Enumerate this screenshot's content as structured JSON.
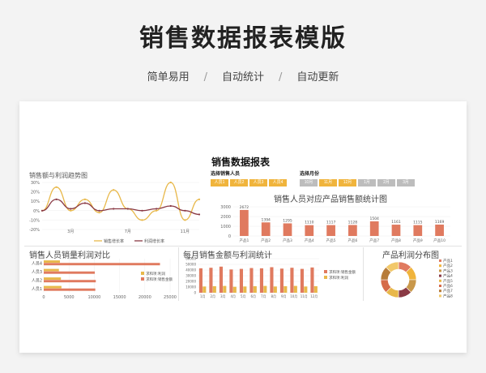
{
  "hero": {
    "title": "销售数据报表模版",
    "features": [
      "简单易用",
      "自动统计",
      "自动更新"
    ],
    "separator": "/"
  },
  "dashboard": {
    "title": "销售数据报表",
    "colors": {
      "primary": "#f0b43c",
      "bar": "#e07a5f",
      "line_dark": "#8a3a45",
      "line_gold": "#e8b84a",
      "chip_off": "#bdbdbd"
    },
    "trend_panel": {
      "title": "销售额与利润趋势图"
    },
    "person_selector": {
      "label": "选择销售人员",
      "options": [
        "人员1",
        "人员2",
        "人员3",
        "人员4"
      ]
    },
    "month_selector": {
      "label": "选择月份",
      "options": [
        "10月",
        "11月",
        "12月",
        "1月",
        "2月",
        "3月"
      ]
    },
    "product_panel": {
      "title": "销售人员对应产品销售额统计图"
    },
    "bar_panel": {
      "title": "销售人员销量利润对比"
    },
    "month_panel": {
      "title": "每月销售金额与利润统计"
    },
    "pie_panel": {
      "title": "产品利润分布图"
    }
  },
  "chart_data": [
    {
      "id": "trend",
      "type": "line",
      "x": [
        "1月",
        "2月",
        "3月",
        "4月",
        "5月",
        "6月",
        "7月",
        "8月",
        "9月",
        "10月",
        "11月",
        "12月"
      ],
      "xlabels": [
        "",
        "",
        "3月",
        "",
        "",
        "",
        "7月",
        "",
        "",
        "",
        "11月",
        ""
      ],
      "yticks": [
        "-20%",
        "-10%",
        "0%",
        "10%",
        "20%",
        "30%"
      ],
      "ylim": [
        -20,
        30
      ],
      "series": [
        {
          "name": "销售增长率",
          "values": [
            0,
            25,
            0,
            12,
            -2,
            22,
            2,
            -10,
            0,
            30,
            -10,
            12
          ]
        },
        {
          "name": "利润增长率",
          "values": [
            0,
            12,
            2,
            8,
            0,
            2,
            2,
            0,
            2,
            5,
            0,
            -4
          ]
        }
      ]
    },
    {
      "id": "product",
      "type": "bar",
      "categories": [
        "产品1",
        "产品2",
        "产品3",
        "产品4",
        "产品5",
        "产品6",
        "产品7",
        "产品8",
        "产品9",
        "产品10"
      ],
      "values": [
        2672,
        1394,
        1295,
        1110,
        1117,
        1128,
        1504,
        1161,
        1115,
        1169
      ],
      "yticks": [
        "0",
        "1000",
        "2000",
        "3000"
      ],
      "ylim": [
        0,
        3000
      ]
    },
    {
      "id": "person",
      "type": "bar",
      "orientation": "horizontal",
      "categories": [
        "人员1",
        "人员2",
        "人员3",
        "人员4"
      ],
      "xticks": [
        "0",
        "5000",
        "10000",
        "15000",
        "20000",
        "25000"
      ],
      "xlim": [
        0,
        25000
      ],
      "series": [
        {
          "name": "求和项:利润",
          "values": [
            3500,
            3400,
            3000,
            3200
          ]
        },
        {
          "name": "求和项:销售金额",
          "values": [
            10200,
            10300,
            10100,
            23000
          ]
        }
      ]
    },
    {
      "id": "monthly",
      "type": "bar",
      "categories": [
        "1月",
        "2月",
        "3月",
        "4月",
        "5月",
        "6月",
        "7月",
        "8月",
        "9月",
        "10月",
        "11月",
        "12月"
      ],
      "yticks": [
        "0",
        "10000",
        "20000",
        "30000",
        "40000",
        "50000",
        "60000"
      ],
      "ylim": [
        0,
        60000
      ],
      "series": [
        {
          "name": "求和项:销售金额",
          "values": [
            43000,
            44000,
            46000,
            41000,
            42000,
            43500,
            43000,
            45000,
            42500,
            44000,
            42000,
            44500
          ]
        },
        {
          "name": "求和项:利润",
          "values": [
            11000,
            11500,
            12000,
            10500,
            11000,
            11500,
            12000,
            11000,
            11500,
            12000,
            11000,
            11500
          ]
        }
      ]
    },
    {
      "id": "profit_pie",
      "type": "pie",
      "categories": [
        "产品1",
        "产品2",
        "产品3",
        "产品4",
        "产品5",
        "产品6",
        "产品7",
        "产品8"
      ],
      "values": [
        12.5,
        12.5,
        12.5,
        12.5,
        12.5,
        12.5,
        12.5,
        12.5
      ],
      "colors": [
        "#e07a5f",
        "#f0b43c",
        "#c9984a",
        "#8a3a45",
        "#e8b84a",
        "#d56b4a",
        "#b77c3a",
        "#f2c86a"
      ]
    }
  ]
}
